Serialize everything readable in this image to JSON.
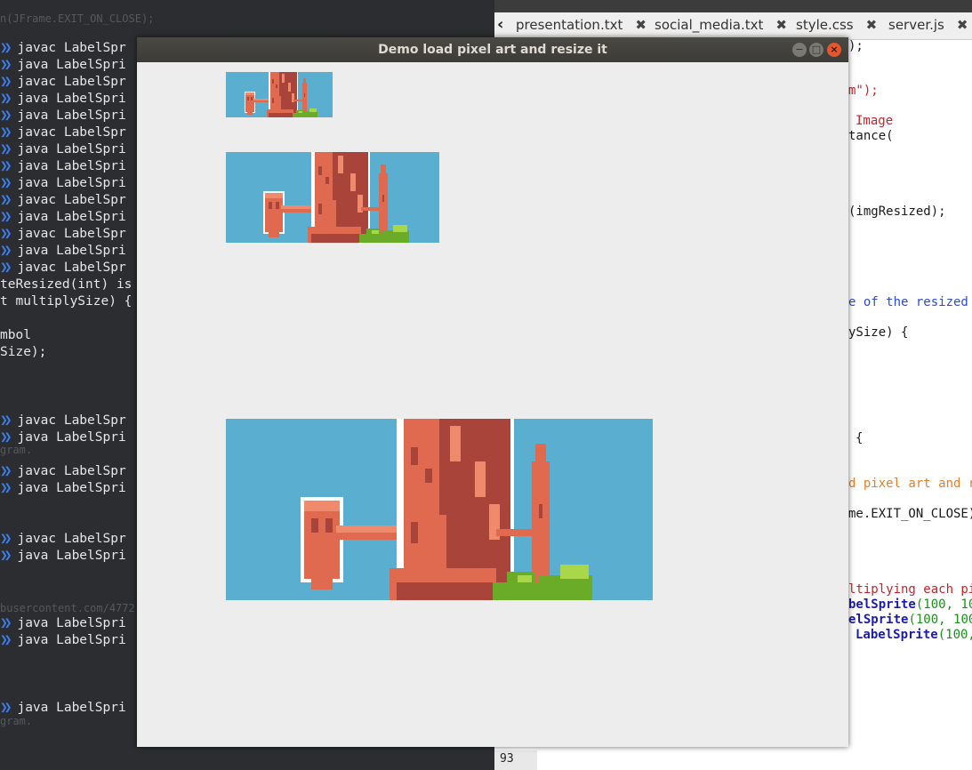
{
  "terminal": {
    "top_line": "n(JFrame.EXIT_ON_CLOSE);",
    "lines": [
      "javac LabelSpr",
      "java LabelSpri",
      "javac LabelSpr",
      "java LabelSpri",
      "java LabelSpri",
      "javac LabelSpr",
      "java LabelSpri",
      "java LabelSpri",
      "java LabelSpri",
      "javac LabelSpr",
      "java LabelSpri",
      "javac LabelSpr",
      "java LabelSpri",
      "javac LabelSpr"
    ],
    "code_lines": [
      "teResized(int) is",
      "t multiplySize) {",
      "",
      "mbol",
      "Size);"
    ],
    "later_lines": [
      "javac LabelSpr",
      "java LabelSpri",
      "javac LabelSpr",
      "java LabelSpri",
      "javac LabelSpr",
      "java LabelSpri",
      "java LabelSpri",
      "java LabelSpri",
      "java LabelSpri"
    ],
    "faint_texts": [
      "gram.",
      "busercontent.com/4772",
      "gram."
    ]
  },
  "editor": {
    "tabs": [
      "presentation.txt",
      "social_media.txt",
      "style.css",
      "server.js"
    ],
    "code": {
      "l1": ");",
      "l2": "m\");",
      "l3": "Image",
      "l4": "tance(",
      "l5": "(imgResized);",
      "l6": "e of the resized s",
      "l7": "ySize) {",
      "l8": "{",
      "l9": "d pixel art and re",
      "l10": "me.EXIT_ON_CLOSE);",
      "l11": "ltiplying each pix",
      "l12a": "belSprite",
      "l12b": "(100, 10",
      "l13a": "elSprite",
      "l13b": "(100, 100",
      "l14a": "LabelSprite",
      "l14b": "(100,"
    },
    "line_number": "93"
  },
  "window": {
    "title": "Demo load pixel art and resize it",
    "controls": {
      "minimize": "−",
      "maximize": "□",
      "close": "×"
    }
  },
  "sprites": [
    {
      "name": "sprite-small",
      "scale": 1
    },
    {
      "name": "sprite-medium",
      "scale": 2
    },
    {
      "name": "sprite-large",
      "scale": 4
    }
  ],
  "colors": {
    "sky": "#5aaed0",
    "castle": "#e06a50",
    "castle_dark": "#a8443a",
    "castle_light": "#f08a6c",
    "outline": "#ffffff",
    "bush": "#6aab28",
    "bush_light": "#a8d84a",
    "chevron": "#3d7ff0",
    "window_bg": "#ededed"
  }
}
